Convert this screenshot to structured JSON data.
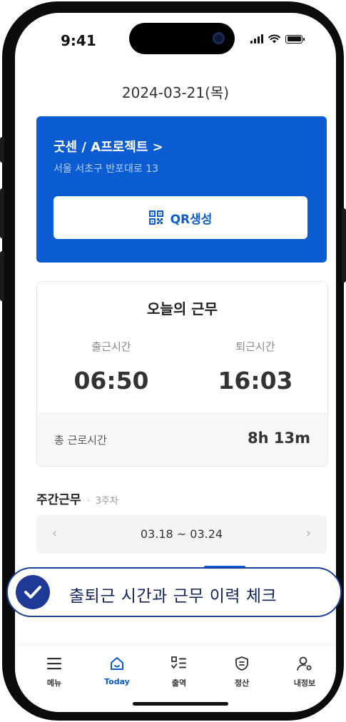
{
  "status_bar": {
    "time": "9:41"
  },
  "header": {
    "date": "2024-03-21(목)"
  },
  "site_card": {
    "project": "굿센 / A프로젝트 >",
    "address": "서울 서초구 반포대로 13",
    "qr_button_label": "QR생성"
  },
  "today_work": {
    "title": "오늘의 근무",
    "clock_in_label": "출근시간",
    "clock_in_time": "06:50",
    "clock_out_label": "퇴근시간",
    "clock_out_time": "16:03",
    "total_label": "총 근로시간",
    "total_value": "8h 13m"
  },
  "weekly": {
    "title": "주간근무",
    "separator": "·",
    "week_label": "3주차",
    "range": "03.18 ~ 03.24",
    "prev": "‹",
    "next": "›"
  },
  "callout": {
    "text": "출퇴근 시간과 근무 이력 체크"
  },
  "tabbar": {
    "items": [
      {
        "label": "메뉴",
        "icon": "menu-icon"
      },
      {
        "label": "Today",
        "icon": "home-icon"
      },
      {
        "label": "출역",
        "icon": "attendance-list-icon"
      },
      {
        "label": "정산",
        "icon": "settlement-icon"
      },
      {
        "label": "내정보",
        "icon": "profile-settings-icon"
      }
    ],
    "active_index": 1
  },
  "colors": {
    "brand_blue": "#0b5bd3",
    "callout_navy": "#1e3a96"
  }
}
